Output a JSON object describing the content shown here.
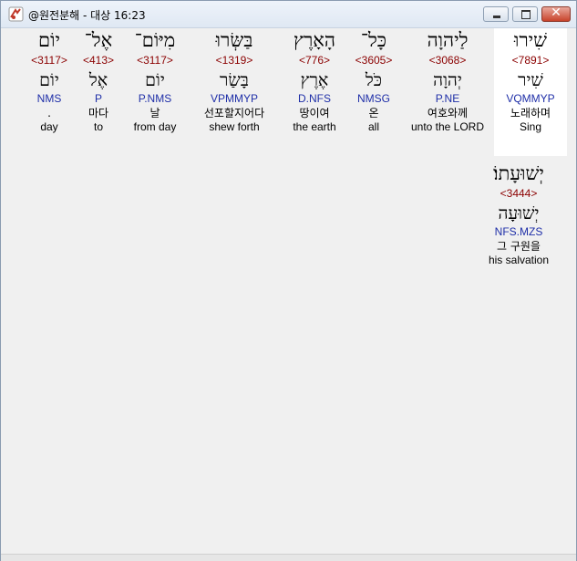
{
  "window": {
    "title": "@원전분해 - 대상 16:23",
    "minimize_icon": "minimize-icon",
    "maximize_icon": "maximize-icon",
    "close_icon": "close-icon"
  },
  "words": [
    {
      "hebrew": "שִׁירוּ",
      "strong": "<7891>",
      "lemma": "שִׁיר",
      "morph": "VQMMYP",
      "korean": "노래하며",
      "english": "Sing",
      "selected": true
    },
    {
      "hebrew": "לַיהוָה",
      "strong": "<3068>",
      "lemma": "יְהוָה",
      "morph": "P.NE",
      "korean": "여호와께",
      "english": "unto the LORD"
    },
    {
      "hebrew": "כָּל־",
      "strong": "<3605>",
      "lemma": "כֹּל",
      "morph": "NMSG",
      "korean": "온",
      "english": "all"
    },
    {
      "hebrew": "הָאָרֶץ",
      "strong": "<776>",
      "lemma": "אֶרֶץ",
      "morph": "D.NFS",
      "korean": "땅이여",
      "english": "the earth"
    },
    {
      "hebrew": "בַּשְּׂרוּ",
      "strong": "<1319>",
      "lemma": "בָּשַׂר",
      "morph": "VPMMYP",
      "korean": "선포할지어다",
      "english": "shew forth"
    },
    {
      "hebrew": "מִיּוֹם־",
      "strong": "<3117>",
      "lemma": "יוֹם",
      "morph": "P.NMS",
      "korean": "날",
      "english": "from day"
    },
    {
      "hebrew": "אֶל־",
      "strong": "<413>",
      "lemma": "אֶל",
      "morph": "P",
      "korean": "마다",
      "english": "to"
    },
    {
      "hebrew": "יוֹם",
      "strong": "<3117>",
      "lemma": "יוֹם",
      "morph": "NMS",
      "korean": ".",
      "english": "day"
    },
    {
      "hebrew": "יְשׁוּעָתוֹ׃",
      "strong": "<3444>",
      "lemma": "יְשׁוּעָה",
      "morph": "NFS.MZS",
      "korean": "그 구원을",
      "english": "his salvation"
    }
  ]
}
